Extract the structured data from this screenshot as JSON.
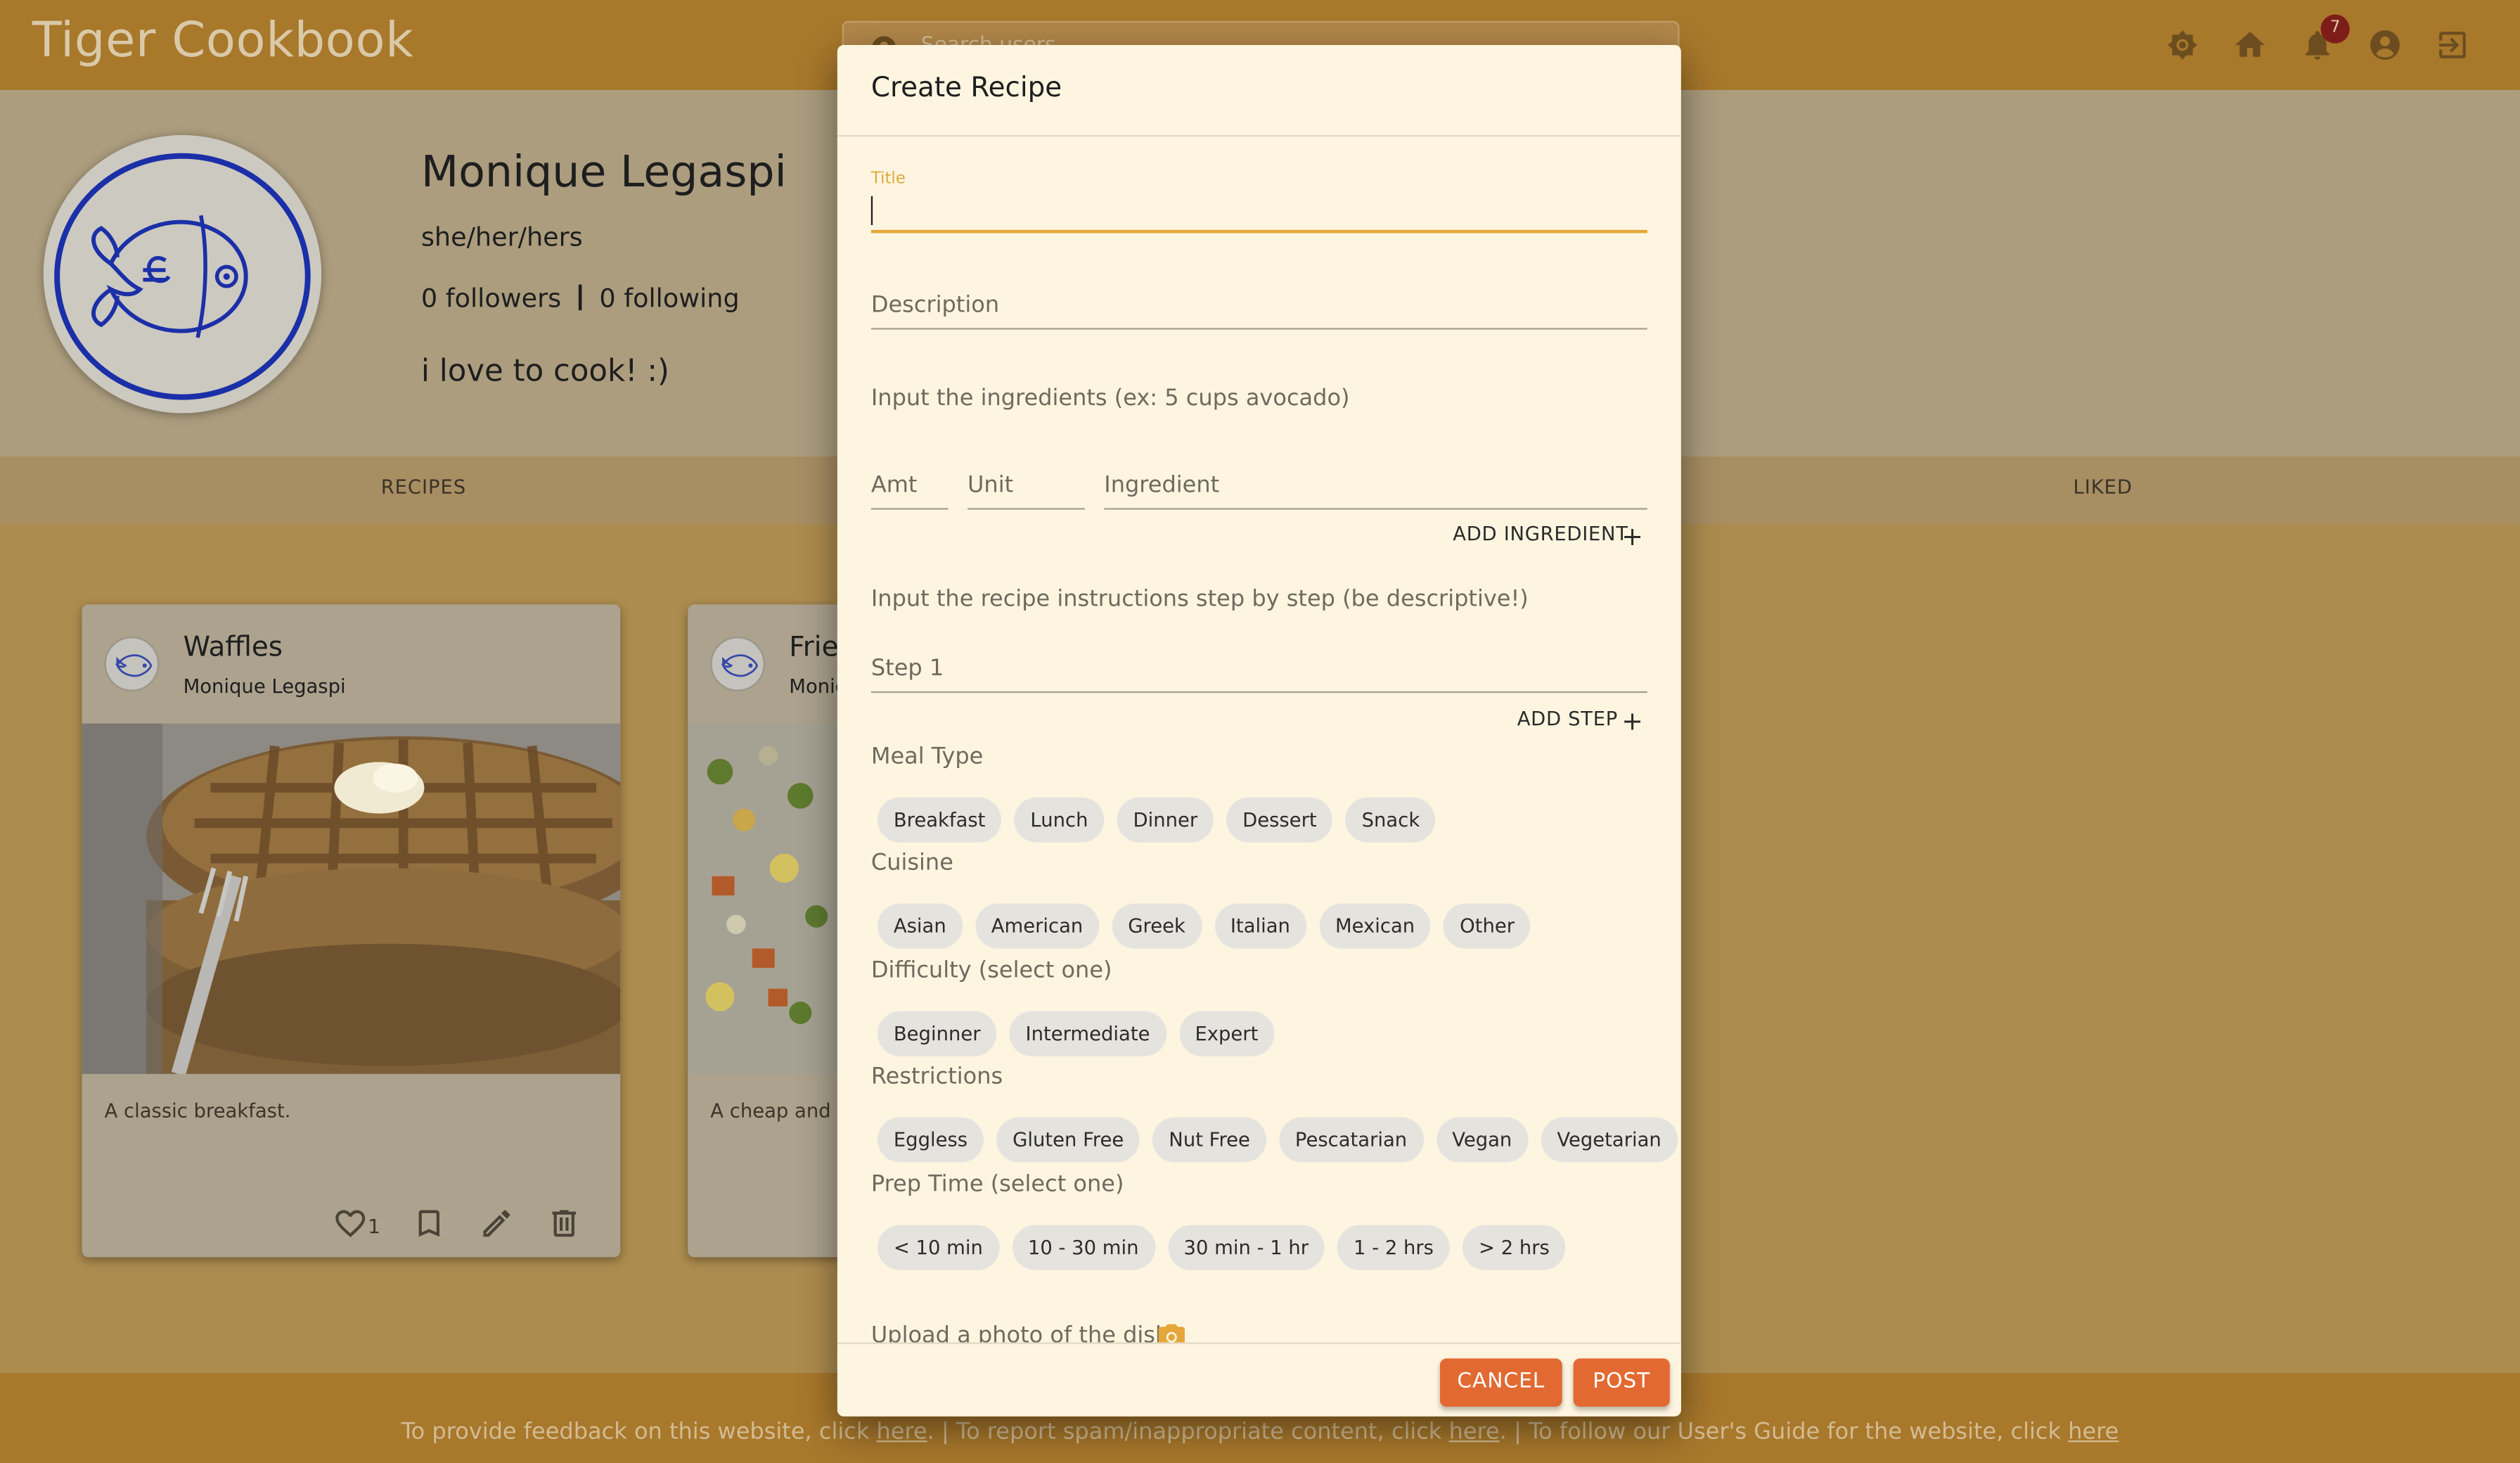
{
  "app": {
    "title": "Tiger Cookbook",
    "search_placeholder": "Search users",
    "notification_count": "7",
    "nav_icons": [
      "theme-icon",
      "home-icon",
      "bell-icon",
      "account-icon",
      "logout-icon"
    ]
  },
  "profile": {
    "name": "Monique Legaspi",
    "pronouns": "she/her/hers",
    "followers": "0 followers",
    "following": "0 following",
    "bio": "i love to cook! :)"
  },
  "tabs": [
    "RECIPES",
    "LIKED"
  ],
  "recipes": [
    {
      "title": "Waffles",
      "author": "Monique Legaspi",
      "description": "A classic breakfast.",
      "likes": "1"
    },
    {
      "title": "Frie",
      "author": "Monic",
      "description": "A cheap and e"
    }
  ],
  "modal": {
    "title": "Create Recipe",
    "title_field_label": "Title",
    "description_placeholder": "Description",
    "ingredients_prompt": "Input the ingredients (ex: 5 cups avocado)",
    "amt_placeholder": "Amt",
    "unit_placeholder": "Unit",
    "ingredient_placeholder": "Ingredient",
    "add_ingredient": "ADD INGREDIENT",
    "instructions_prompt": "Input the recipe instructions step by step (be descriptive!)",
    "step_placeholder": "Step 1",
    "add_step": "ADD STEP",
    "meal_type_label": "Meal Type",
    "meal_types": [
      "Breakfast",
      "Lunch",
      "Dinner",
      "Dessert",
      "Snack"
    ],
    "cuisine_label": "Cuisine",
    "cuisines": [
      "Asian",
      "American",
      "Greek",
      "Italian",
      "Mexican",
      "Other"
    ],
    "difficulty_label": "Difficulty (select one)",
    "difficulties": [
      "Beginner",
      "Intermediate",
      "Expert"
    ],
    "restrictions_label": "Restrictions",
    "restrictions": [
      "Eggless",
      "Gluten Free",
      "Nut Free",
      "Pescatarian",
      "Vegan",
      "Vegetarian"
    ],
    "prep_time_label": "Prep Time (select one)",
    "prep_times": [
      "< 10 min",
      "10 - 30 min",
      "30 min - 1 hr",
      "1 - 2 hrs",
      "> 2 hrs"
    ],
    "upload_label": "Upload a photo of the dish",
    "cancel": "CANCEL",
    "post": "POST"
  },
  "footer": {
    "part1": "To provide feedback on this website, click ",
    "link": "here",
    "part2": ". | To report spam/inappropriate content, click ",
    "part3": ". | To follow our User's Guide for the website, click "
  },
  "colors": {
    "accent": "#e5a73a",
    "button": "#e26a32",
    "modal_bg": "#fdf5e0",
    "chip": "#e5e3de"
  }
}
